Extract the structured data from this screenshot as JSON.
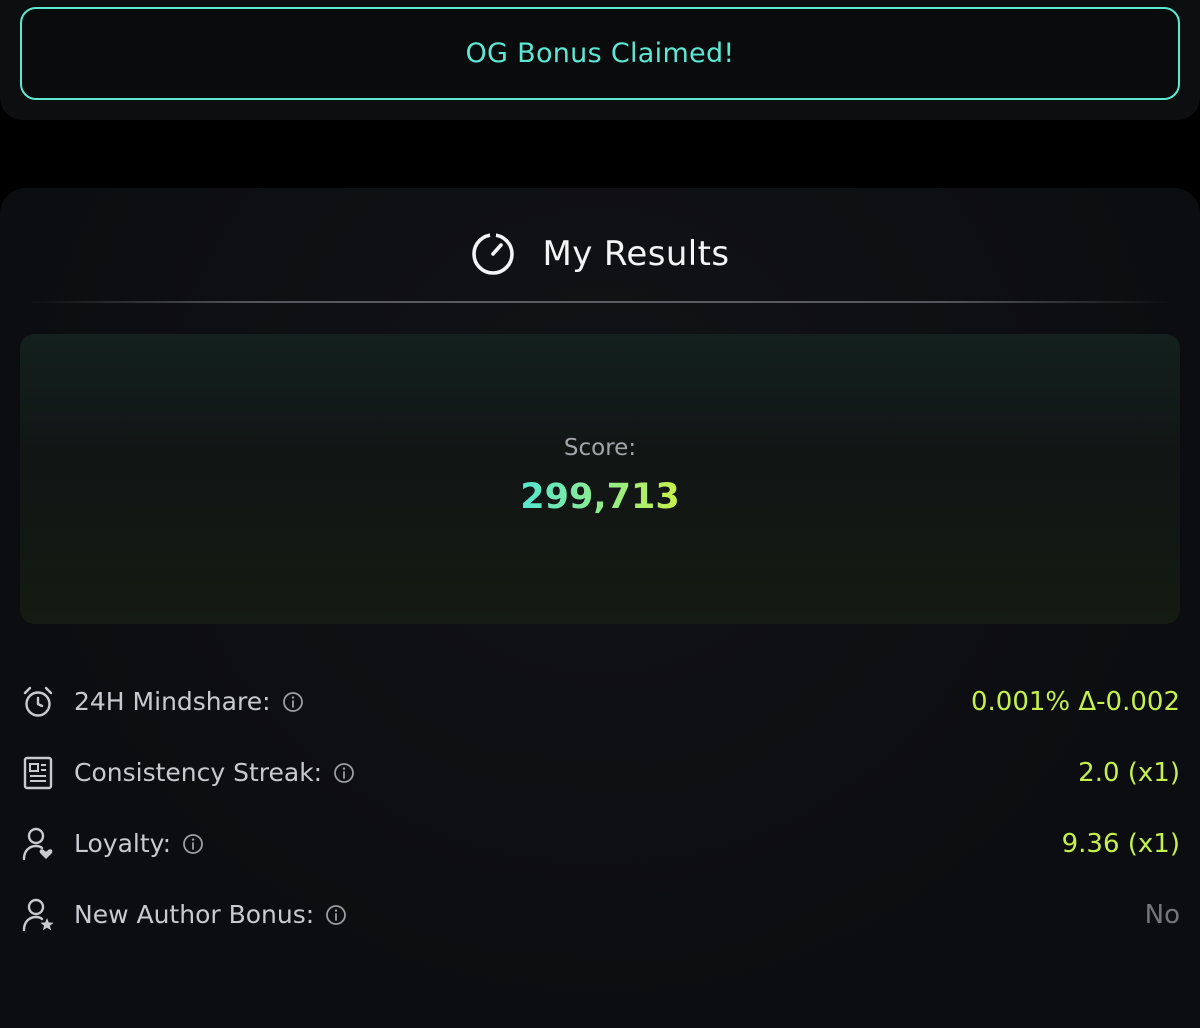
{
  "og_banner": {
    "label": "OG Bonus Claimed!"
  },
  "results": {
    "title": "My Results",
    "icon": "gauge-icon",
    "score_label": "Score:",
    "score_value": "299,713"
  },
  "stats": [
    {
      "icon": "alarm-clock-icon",
      "label": "24H Mindshare:",
      "value": "0.001% Δ-0.002"
    },
    {
      "icon": "document-icon",
      "label": "Consistency Streak:",
      "value": "2.0 (x1)"
    },
    {
      "icon": "user-heart-icon",
      "label": "Loyalty:",
      "value": "9.36 (x1)"
    },
    {
      "icon": "user-star-icon",
      "label": "New Author Bonus:",
      "value": "No"
    }
  ],
  "colors": {
    "accent_teal": "#5ce8d3",
    "accent_lime": "#c6f04c",
    "muted_value": "#74757b",
    "background": "#000000"
  }
}
